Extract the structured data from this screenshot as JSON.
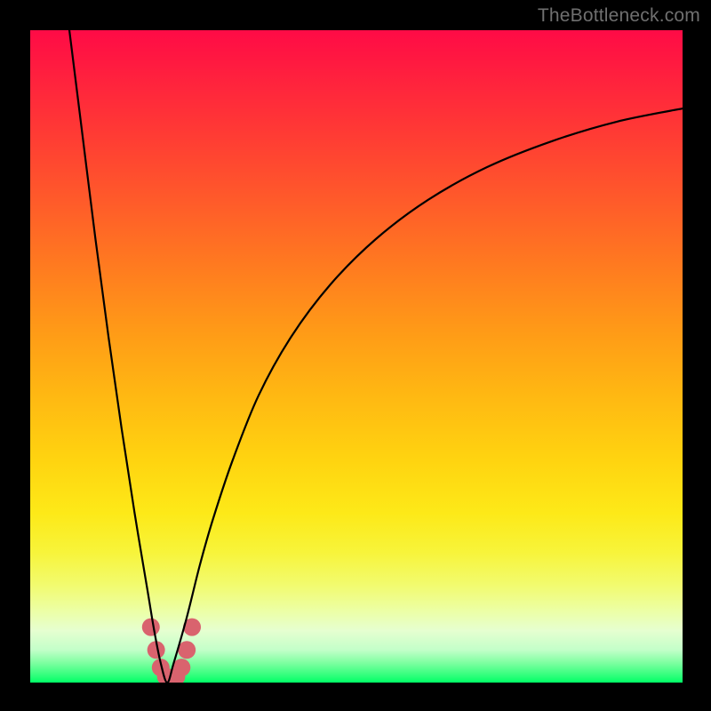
{
  "watermark": "TheBottleneck.com",
  "chart_data": {
    "type": "line",
    "title": "",
    "xlabel": "",
    "ylabel": "",
    "xlim": [
      0,
      100
    ],
    "ylim": [
      0,
      100
    ],
    "grid": false,
    "legend": false,
    "minimum_x": 21,
    "series": [
      {
        "name": "left-branch",
        "x": [
          6,
          8,
          10,
          12,
          14,
          16,
          18,
          19,
          20,
          21
        ],
        "values": [
          100,
          84,
          68,
          53,
          39,
          26,
          14,
          8,
          3,
          0
        ]
      },
      {
        "name": "right-branch",
        "x": [
          21,
          22,
          24,
          26,
          28,
          31,
          35,
          40,
          46,
          53,
          61,
          70,
          80,
          90,
          100
        ],
        "values": [
          0,
          3,
          10,
          18,
          25,
          34,
          44,
          53,
          61,
          68,
          74,
          79,
          83,
          86,
          88
        ]
      }
    ],
    "markers": {
      "name": "highlight-near-minimum",
      "color": "#d9636e",
      "radius_px": 10,
      "points_xy": [
        [
          18.5,
          8.5
        ],
        [
          19.3,
          5.0
        ],
        [
          20.0,
          2.3
        ],
        [
          20.8,
          0.9
        ],
        [
          21.6,
          0.6
        ],
        [
          22.4,
          0.9
        ],
        [
          23.2,
          2.3
        ],
        [
          24.0,
          5.0
        ],
        [
          24.8,
          8.5
        ]
      ]
    },
    "background_gradient_stops": [
      {
        "pos": 0.0,
        "color": "#ff0b46"
      },
      {
        "pos": 0.5,
        "color": "#ffae14"
      },
      {
        "pos": 0.8,
        "color": "#f7f43a"
      },
      {
        "pos": 1.0,
        "color": "#00ff66"
      }
    ]
  }
}
